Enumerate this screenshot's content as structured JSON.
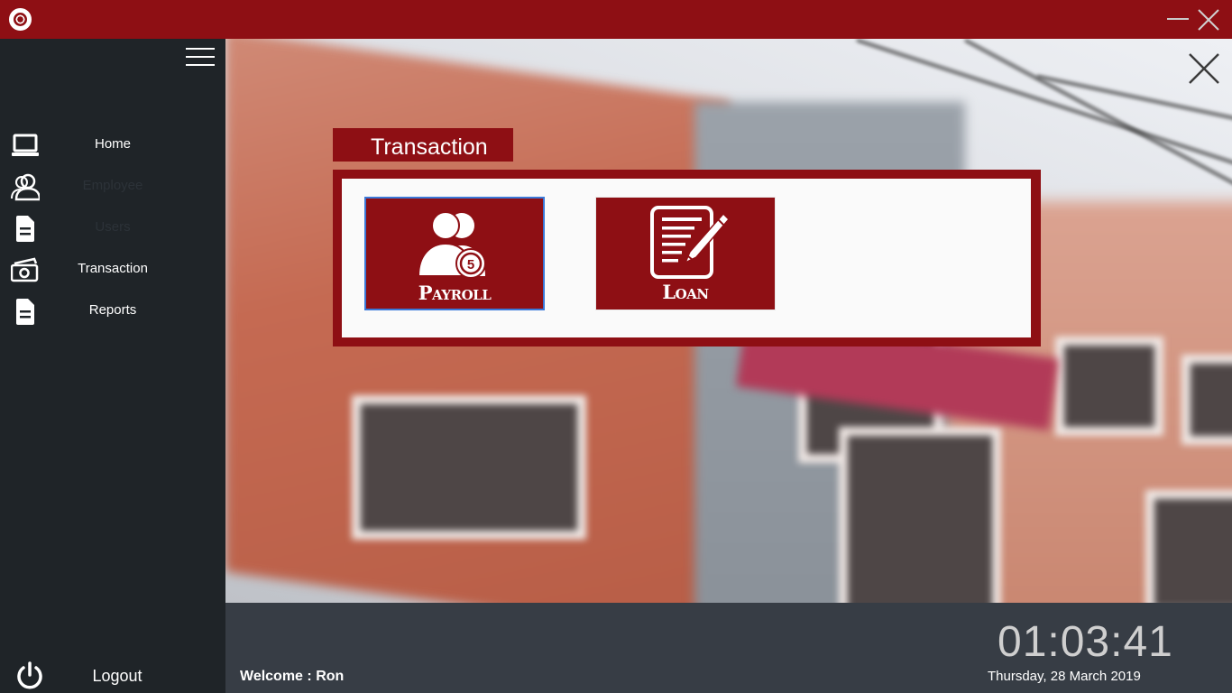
{
  "app": {
    "logo_icon": "school-seal-logo",
    "accent_color": "#8e0f14"
  },
  "window_controls": {
    "minimize_icon": "minimize-icon",
    "close_icon": "close-icon"
  },
  "sidebar": {
    "menu_icon": "hamburger-menu-icon",
    "items": [
      {
        "label": "Home",
        "icon": "laptop-icon"
      },
      {
        "label": "Employee",
        "icon": "user-icon"
      },
      {
        "label": "Users",
        "icon": "document-icon"
      },
      {
        "label": "Transaction",
        "icon": "money-icon"
      },
      {
        "label": "Reports",
        "icon": "report-icon"
      }
    ],
    "logout": {
      "label": "Logout",
      "icon": "power-icon"
    }
  },
  "main": {
    "close_icon": "close-icon",
    "section_title": "Transaction",
    "tiles": [
      {
        "label": "Payroll",
        "icon": "payroll-icon",
        "badge": "5"
      },
      {
        "label": "Loan",
        "icon": "contract-pen-icon"
      }
    ]
  },
  "footer": {
    "welcome_label": "Welcome",
    "welcome_separator": ":",
    "user_name": "Ron",
    "time": "01:03:41",
    "date": "Thursday, 28 March 2019"
  }
}
